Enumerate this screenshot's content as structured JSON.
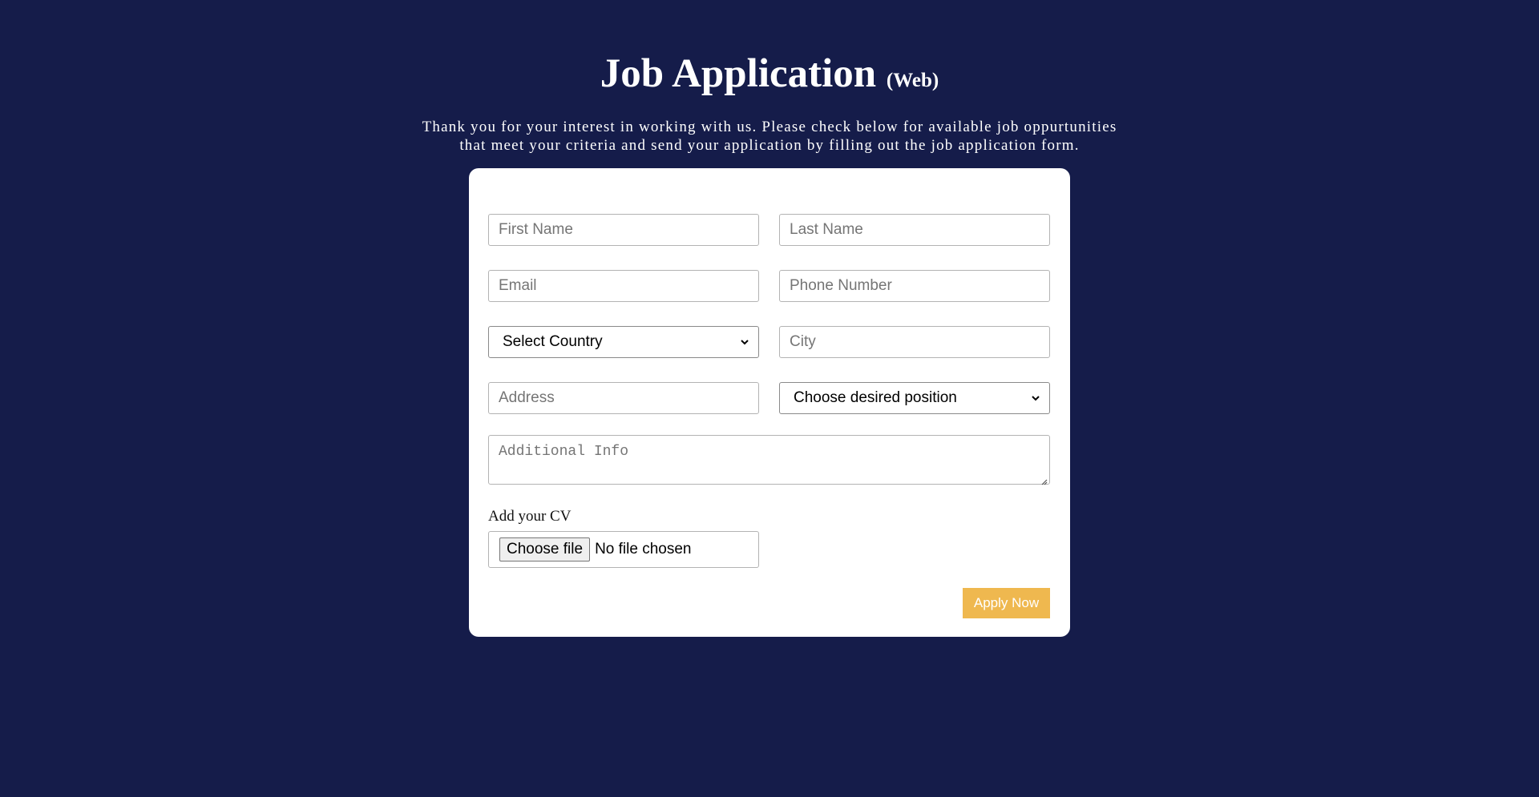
{
  "header": {
    "title": "Job Application",
    "title_suffix": "(Web)",
    "intro_line1": "Thank you for your interest in working with us. Please check below for available job oppurtunities",
    "intro_line2": "that meet your criteria and send your application by filling out the job application form."
  },
  "form": {
    "first_name_placeholder": "First Name",
    "last_name_placeholder": "Last Name",
    "email_placeholder": "Email",
    "phone_placeholder": "Phone Number",
    "country_selected": "Select Country",
    "city_placeholder": "City",
    "address_placeholder": "Address",
    "position_selected": "Choose desired position",
    "additional_info_placeholder": "Additional Info",
    "cv_label": "Add your CV",
    "file_button_label": "Choose file",
    "file_status": "No file chosen",
    "submit_label": "Apply Now"
  },
  "icons": {
    "select_arrow": "chevron-down-icon",
    "textarea_resize": "resize-grip-icon"
  },
  "colors": {
    "background": "#151c4a",
    "card": "#ffffff",
    "accent": "#efb84f"
  }
}
